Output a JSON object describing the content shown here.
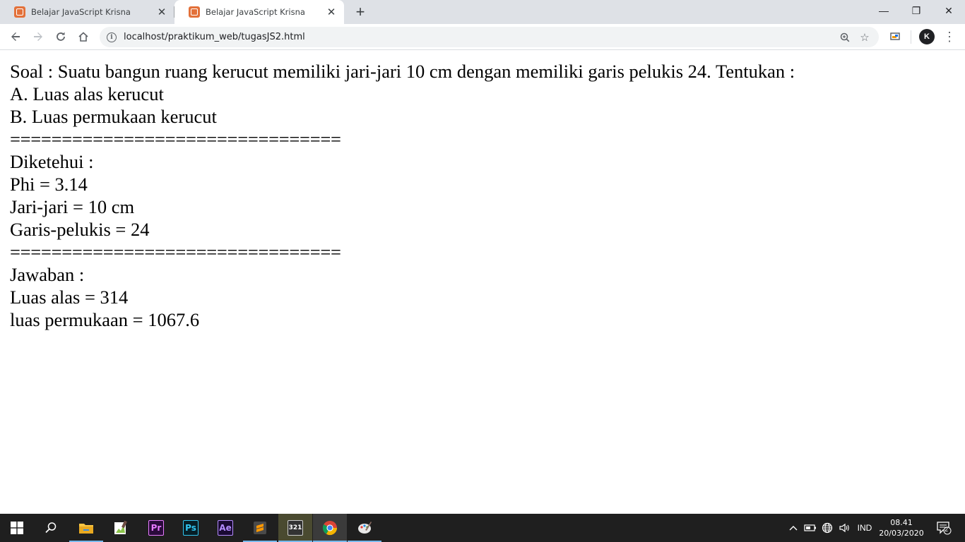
{
  "browser": {
    "tabs": [
      {
        "title": "Belajar JavaScript Krisna",
        "active": false
      },
      {
        "title": "Belajar JavaScript Krisna",
        "active": true
      }
    ],
    "new_tab_label": "+",
    "window_controls": {
      "minimize": "—",
      "restore": "❐",
      "close": "✕"
    },
    "url": "localhost/praktikum_web/tugasJS2.html",
    "profile_initial": "K"
  },
  "page": {
    "lines": [
      "Soal : Suatu bangun ruang kerucut memiliki jari-jari 10 cm dengan memiliki garis pelukis 24. Tentukan :",
      "A. Luas alas kerucut",
      "B. Luas permukaan kerucut",
      "================================",
      "Diketehui :",
      "Phi = 3.14",
      "Jari-jari = 10 cm",
      "Garis-pelukis = 24",
      "================================",
      "Jawaban :",
      "Luas alas = 314",
      "luas permukaan = 1067.6"
    ]
  },
  "taskbar": {
    "apps": [
      "start",
      "search",
      "file-explorer",
      "notepad-plus",
      "premiere-pro",
      "photoshop",
      "after-effects",
      "sublime-text",
      "321-player",
      "chrome",
      "paint"
    ],
    "premiere_label": "Pr",
    "photoshop_label": "Ps",
    "aftereffects_label": "Ae",
    "player_label": "321",
    "language": "IND",
    "time": "08.41",
    "date": "20/03/2020",
    "notification_count": "2"
  }
}
